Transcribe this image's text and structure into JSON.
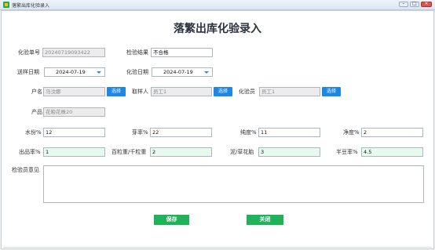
{
  "window": {
    "title": "落繁出库化验录入"
  },
  "page": {
    "heading": "落繁出库化验录入"
  },
  "row1": {
    "lab_no_label": "化验单号",
    "lab_no_value": "20240719093422",
    "result_label": "检验结果",
    "result_value": "不合格"
  },
  "row2": {
    "send_date_label": "送样日期",
    "send_date_value": "2024-07-19",
    "test_date_label": "化验日期",
    "test_date_value": "2024-07-19"
  },
  "row3": {
    "household_label": "户名",
    "household_value": "马汶娜",
    "household_btn": "选择",
    "sampler_label": "取样人",
    "sampler_value": "员工1",
    "sampler_btn": "选择",
    "tester_label": "化验员",
    "tester_value": "员工1",
    "tester_btn": "选择"
  },
  "row4": {
    "product_label": "产品",
    "product_value": "花粮花株20"
  },
  "row5": {
    "moisture_label": "水份%",
    "moisture_value": "12",
    "germination_label": "芽率%",
    "germination_value": "22",
    "purity_label": "纯度%",
    "purity_value": "11",
    "cleanliness_label": "净度%",
    "cleanliness_value": "2"
  },
  "row6": {
    "yield_label": "出品率%",
    "yield_value": "1",
    "weight_label": "百粒重/千粒重",
    "weight_value": "2",
    "mud_label": "泥/草花胎",
    "mud_value": "3",
    "half_label": "半豆率%",
    "half_value": "4.5"
  },
  "opinion": {
    "label": "检验员意见",
    "value": ""
  },
  "actions": {
    "save": "保存",
    "close": "关闭"
  },
  "colors": {
    "accent_blue": "#1c87e6",
    "action_green": "#20b15b",
    "field_green": "#e7faee"
  }
}
